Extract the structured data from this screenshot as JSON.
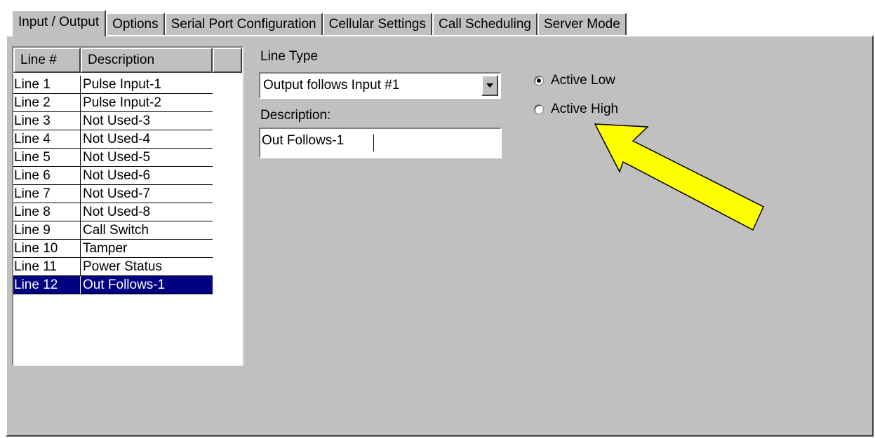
{
  "tabs": [
    {
      "label": "Input / Output",
      "active": true
    },
    {
      "label": "Options",
      "active": false
    },
    {
      "label": "Serial Port Configuration",
      "active": false
    },
    {
      "label": "Cellular Settings",
      "active": false
    },
    {
      "label": "Call Scheduling",
      "active": false
    },
    {
      "label": "Server Mode",
      "active": false
    }
  ],
  "list": {
    "columns": [
      "Line #",
      "Description"
    ],
    "rows": [
      {
        "line": "Line 1",
        "description": "Pulse Input-1"
      },
      {
        "line": "Line 2",
        "description": "Pulse Input-2"
      },
      {
        "line": "Line 3",
        "description": "Not Used-3"
      },
      {
        "line": "Line 4",
        "description": "Not Used-4"
      },
      {
        "line": "Line 5",
        "description": "Not Used-5"
      },
      {
        "line": "Line 6",
        "description": "Not Used-6"
      },
      {
        "line": "Line 7",
        "description": "Not Used-7"
      },
      {
        "line": "Line 8",
        "description": "Not Used-8"
      },
      {
        "line": "Line 9",
        "description": "Call Switch"
      },
      {
        "line": "Line 10",
        "description": "Tamper"
      },
      {
        "line": "Line 11",
        "description": "Power Status"
      },
      {
        "line": "Line 12",
        "description": "Out Follows-1"
      }
    ],
    "selected_row": "Line 12"
  },
  "form": {
    "line_type_label": "Line Type",
    "line_type_value": "Output follows Input #1",
    "description_label": "Description:",
    "description_value": "Out Follows-1"
  },
  "polarity": {
    "options": [
      {
        "label": "Active Low",
        "checked": true
      },
      {
        "label": "Active High",
        "checked": false
      }
    ]
  },
  "colors": {
    "panel": "#c0c0c0",
    "selection": "#000080",
    "arrow_fill": "#ffff00"
  },
  "icons": [
    "dropdown-arrow-icon",
    "pointer-arrow-icon"
  ]
}
